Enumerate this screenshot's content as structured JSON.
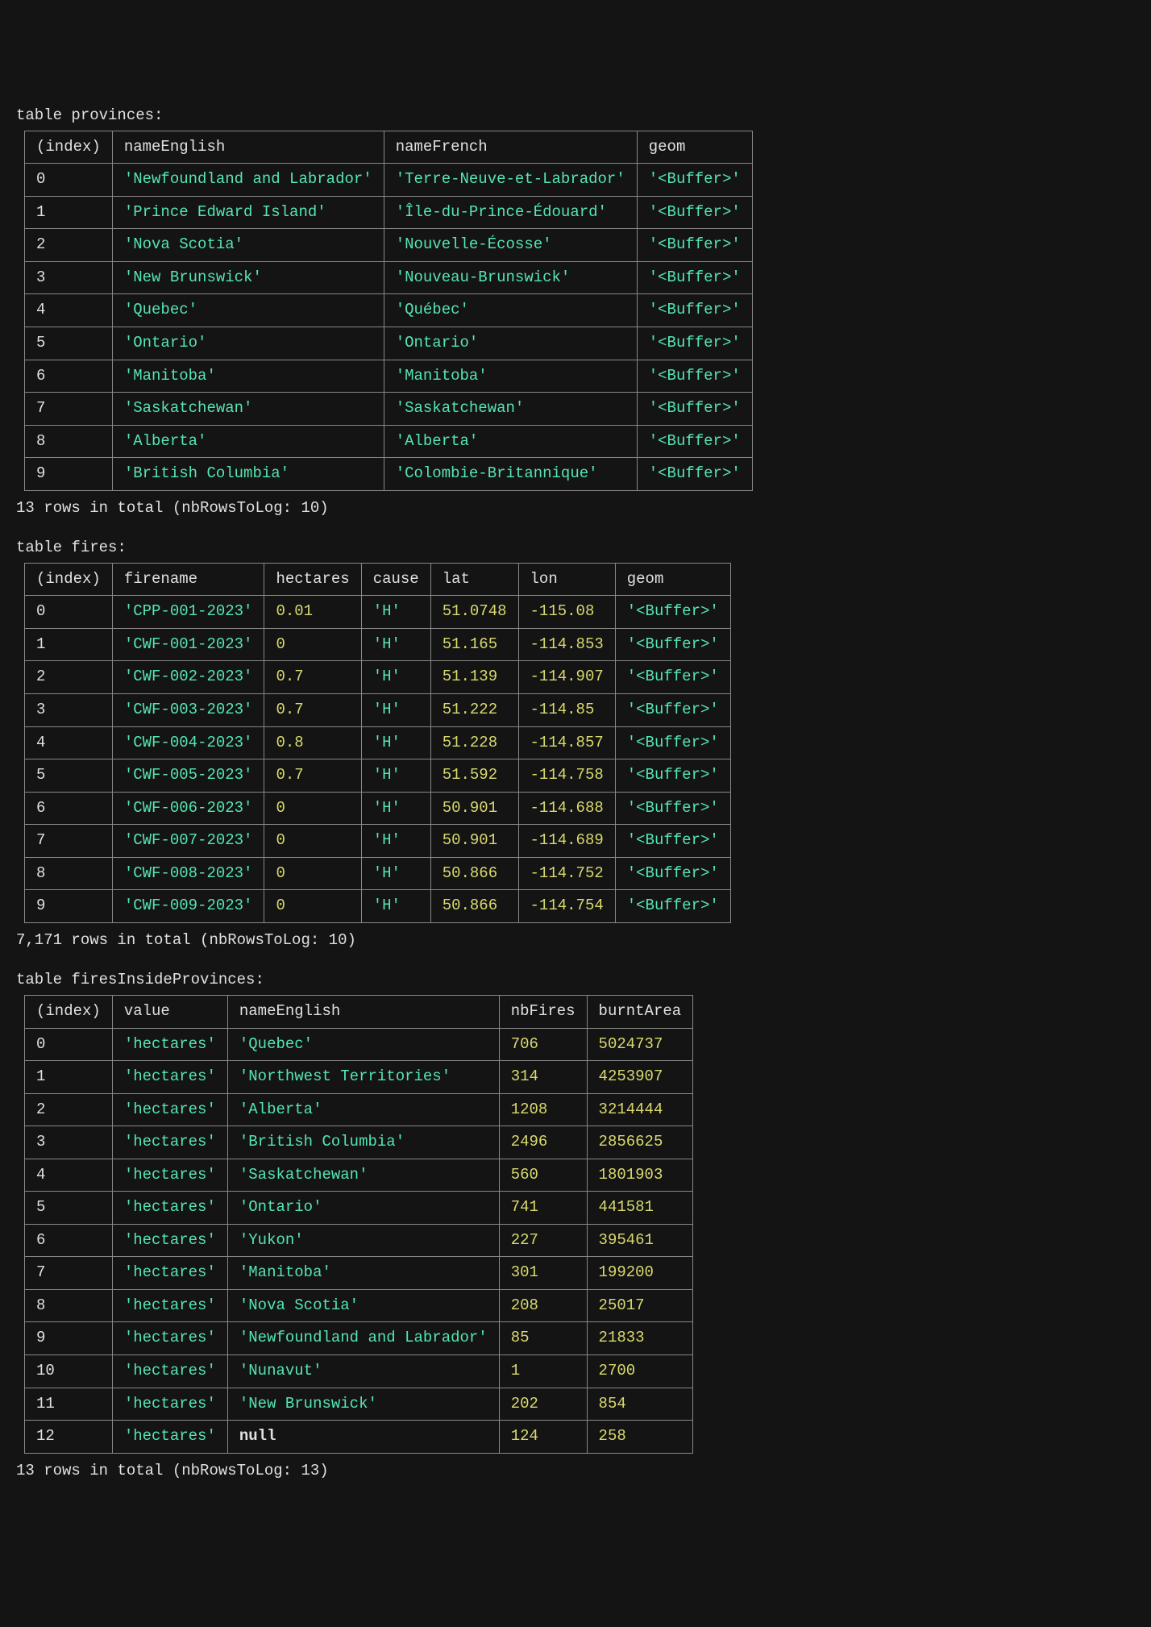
{
  "tables": [
    {
      "title": "table provinces:",
      "columns": [
        "(index)",
        "nameEnglish",
        "nameFrench",
        "geom"
      ],
      "rows": [
        [
          {
            "v": "0",
            "t": "idx"
          },
          {
            "v": "'Newfoundland and Labrador'",
            "t": "str"
          },
          {
            "v": "'Terre-Neuve-et-Labrador'",
            "t": "str"
          },
          {
            "v": "'<Buffer>'",
            "t": "str"
          }
        ],
        [
          {
            "v": "1",
            "t": "idx"
          },
          {
            "v": "'Prince Edward Island'",
            "t": "str"
          },
          {
            "v": "'Île-du-Prince-Édouard'",
            "t": "str"
          },
          {
            "v": "'<Buffer>'",
            "t": "str"
          }
        ],
        [
          {
            "v": "2",
            "t": "idx"
          },
          {
            "v": "'Nova Scotia'",
            "t": "str"
          },
          {
            "v": "'Nouvelle-Écosse'",
            "t": "str"
          },
          {
            "v": "'<Buffer>'",
            "t": "str"
          }
        ],
        [
          {
            "v": "3",
            "t": "idx"
          },
          {
            "v": "'New Brunswick'",
            "t": "str"
          },
          {
            "v": "'Nouveau-Brunswick'",
            "t": "str"
          },
          {
            "v": "'<Buffer>'",
            "t": "str"
          }
        ],
        [
          {
            "v": "4",
            "t": "idx"
          },
          {
            "v": "'Quebec'",
            "t": "str"
          },
          {
            "v": "'Québec'",
            "t": "str"
          },
          {
            "v": "'<Buffer>'",
            "t": "str"
          }
        ],
        [
          {
            "v": "5",
            "t": "idx"
          },
          {
            "v": "'Ontario'",
            "t": "str"
          },
          {
            "v": "'Ontario'",
            "t": "str"
          },
          {
            "v": "'<Buffer>'",
            "t": "str"
          }
        ],
        [
          {
            "v": "6",
            "t": "idx"
          },
          {
            "v": "'Manitoba'",
            "t": "str"
          },
          {
            "v": "'Manitoba'",
            "t": "str"
          },
          {
            "v": "'<Buffer>'",
            "t": "str"
          }
        ],
        [
          {
            "v": "7",
            "t": "idx"
          },
          {
            "v": "'Saskatchewan'",
            "t": "str"
          },
          {
            "v": "'Saskatchewan'",
            "t": "str"
          },
          {
            "v": "'<Buffer>'",
            "t": "str"
          }
        ],
        [
          {
            "v": "8",
            "t": "idx"
          },
          {
            "v": "'Alberta'",
            "t": "str"
          },
          {
            "v": "'Alberta'",
            "t": "str"
          },
          {
            "v": "'<Buffer>'",
            "t": "str"
          }
        ],
        [
          {
            "v": "9",
            "t": "idx"
          },
          {
            "v": "'British Columbia'",
            "t": "str"
          },
          {
            "v": "'Colombie-Britannique'",
            "t": "str"
          },
          {
            "v": "'<Buffer>'",
            "t": "str"
          }
        ]
      ],
      "summary": "13 rows in total (nbRowsToLog: 10)"
    },
    {
      "title": "table fires:",
      "columns": [
        "(index)",
        "firename",
        "hectares",
        "cause",
        "lat",
        "lon",
        "geom"
      ],
      "rows": [
        [
          {
            "v": "0",
            "t": "idx"
          },
          {
            "v": "'CPP-001-2023'",
            "t": "str"
          },
          {
            "v": "0.01",
            "t": "num"
          },
          {
            "v": "'H'",
            "t": "str"
          },
          {
            "v": "51.0748",
            "t": "num"
          },
          {
            "v": "-115.08",
            "t": "num"
          },
          {
            "v": "'<Buffer>'",
            "t": "str"
          }
        ],
        [
          {
            "v": "1",
            "t": "idx"
          },
          {
            "v": "'CWF-001-2023'",
            "t": "str"
          },
          {
            "v": "0",
            "t": "num"
          },
          {
            "v": "'H'",
            "t": "str"
          },
          {
            "v": "51.165",
            "t": "num"
          },
          {
            "v": "-114.853",
            "t": "num"
          },
          {
            "v": "'<Buffer>'",
            "t": "str"
          }
        ],
        [
          {
            "v": "2",
            "t": "idx"
          },
          {
            "v": "'CWF-002-2023'",
            "t": "str"
          },
          {
            "v": "0.7",
            "t": "num"
          },
          {
            "v": "'H'",
            "t": "str"
          },
          {
            "v": "51.139",
            "t": "num"
          },
          {
            "v": "-114.907",
            "t": "num"
          },
          {
            "v": "'<Buffer>'",
            "t": "str"
          }
        ],
        [
          {
            "v": "3",
            "t": "idx"
          },
          {
            "v": "'CWF-003-2023'",
            "t": "str"
          },
          {
            "v": "0.7",
            "t": "num"
          },
          {
            "v": "'H'",
            "t": "str"
          },
          {
            "v": "51.222",
            "t": "num"
          },
          {
            "v": "-114.85",
            "t": "num"
          },
          {
            "v": "'<Buffer>'",
            "t": "str"
          }
        ],
        [
          {
            "v": "4",
            "t": "idx"
          },
          {
            "v": "'CWF-004-2023'",
            "t": "str"
          },
          {
            "v": "0.8",
            "t": "num"
          },
          {
            "v": "'H'",
            "t": "str"
          },
          {
            "v": "51.228",
            "t": "num"
          },
          {
            "v": "-114.857",
            "t": "num"
          },
          {
            "v": "'<Buffer>'",
            "t": "str"
          }
        ],
        [
          {
            "v": "5",
            "t": "idx"
          },
          {
            "v": "'CWF-005-2023'",
            "t": "str"
          },
          {
            "v": "0.7",
            "t": "num"
          },
          {
            "v": "'H'",
            "t": "str"
          },
          {
            "v": "51.592",
            "t": "num"
          },
          {
            "v": "-114.758",
            "t": "num"
          },
          {
            "v": "'<Buffer>'",
            "t": "str"
          }
        ],
        [
          {
            "v": "6",
            "t": "idx"
          },
          {
            "v": "'CWF-006-2023'",
            "t": "str"
          },
          {
            "v": "0",
            "t": "num"
          },
          {
            "v": "'H'",
            "t": "str"
          },
          {
            "v": "50.901",
            "t": "num"
          },
          {
            "v": "-114.688",
            "t": "num"
          },
          {
            "v": "'<Buffer>'",
            "t": "str"
          }
        ],
        [
          {
            "v": "7",
            "t": "idx"
          },
          {
            "v": "'CWF-007-2023'",
            "t": "str"
          },
          {
            "v": "0",
            "t": "num"
          },
          {
            "v": "'H'",
            "t": "str"
          },
          {
            "v": "50.901",
            "t": "num"
          },
          {
            "v": "-114.689",
            "t": "num"
          },
          {
            "v": "'<Buffer>'",
            "t": "str"
          }
        ],
        [
          {
            "v": "8",
            "t": "idx"
          },
          {
            "v": "'CWF-008-2023'",
            "t": "str"
          },
          {
            "v": "0",
            "t": "num"
          },
          {
            "v": "'H'",
            "t": "str"
          },
          {
            "v": "50.866",
            "t": "num"
          },
          {
            "v": "-114.752",
            "t": "num"
          },
          {
            "v": "'<Buffer>'",
            "t": "str"
          }
        ],
        [
          {
            "v": "9",
            "t": "idx"
          },
          {
            "v": "'CWF-009-2023'",
            "t": "str"
          },
          {
            "v": "0",
            "t": "num"
          },
          {
            "v": "'H'",
            "t": "str"
          },
          {
            "v": "50.866",
            "t": "num"
          },
          {
            "v": "-114.754",
            "t": "num"
          },
          {
            "v": "'<Buffer>'",
            "t": "str"
          }
        ]
      ],
      "summary": "7,171 rows in total (nbRowsToLog: 10)"
    },
    {
      "title": "table firesInsideProvinces:",
      "columns": [
        "(index)",
        "value",
        "nameEnglish",
        "nbFires",
        "burntArea"
      ],
      "rows": [
        [
          {
            "v": "0",
            "t": "idx"
          },
          {
            "v": "'hectares'",
            "t": "str"
          },
          {
            "v": "'Quebec'",
            "t": "str"
          },
          {
            "v": "706",
            "t": "num"
          },
          {
            "v": "5024737",
            "t": "num"
          }
        ],
        [
          {
            "v": "1",
            "t": "idx"
          },
          {
            "v": "'hectares'",
            "t": "str"
          },
          {
            "v": "'Northwest Territories'",
            "t": "str"
          },
          {
            "v": "314",
            "t": "num"
          },
          {
            "v": "4253907",
            "t": "num"
          }
        ],
        [
          {
            "v": "2",
            "t": "idx"
          },
          {
            "v": "'hectares'",
            "t": "str"
          },
          {
            "v": "'Alberta'",
            "t": "str"
          },
          {
            "v": "1208",
            "t": "num"
          },
          {
            "v": "3214444",
            "t": "num"
          }
        ],
        [
          {
            "v": "3",
            "t": "idx"
          },
          {
            "v": "'hectares'",
            "t": "str"
          },
          {
            "v": "'British Columbia'",
            "t": "str"
          },
          {
            "v": "2496",
            "t": "num"
          },
          {
            "v": "2856625",
            "t": "num"
          }
        ],
        [
          {
            "v": "4",
            "t": "idx"
          },
          {
            "v": "'hectares'",
            "t": "str"
          },
          {
            "v": "'Saskatchewan'",
            "t": "str"
          },
          {
            "v": "560",
            "t": "num"
          },
          {
            "v": "1801903",
            "t": "num"
          }
        ],
        [
          {
            "v": "5",
            "t": "idx"
          },
          {
            "v": "'hectares'",
            "t": "str"
          },
          {
            "v": "'Ontario'",
            "t": "str"
          },
          {
            "v": "741",
            "t": "num"
          },
          {
            "v": "441581",
            "t": "num"
          }
        ],
        [
          {
            "v": "6",
            "t": "idx"
          },
          {
            "v": "'hectares'",
            "t": "str"
          },
          {
            "v": "'Yukon'",
            "t": "str"
          },
          {
            "v": "227",
            "t": "num"
          },
          {
            "v": "395461",
            "t": "num"
          }
        ],
        [
          {
            "v": "7",
            "t": "idx"
          },
          {
            "v": "'hectares'",
            "t": "str"
          },
          {
            "v": "'Manitoba'",
            "t": "str"
          },
          {
            "v": "301",
            "t": "num"
          },
          {
            "v": "199200",
            "t": "num"
          }
        ],
        [
          {
            "v": "8",
            "t": "idx"
          },
          {
            "v": "'hectares'",
            "t": "str"
          },
          {
            "v": "'Nova Scotia'",
            "t": "str"
          },
          {
            "v": "208",
            "t": "num"
          },
          {
            "v": "25017",
            "t": "num"
          }
        ],
        [
          {
            "v": "9",
            "t": "idx"
          },
          {
            "v": "'hectares'",
            "t": "str"
          },
          {
            "v": "'Newfoundland and Labrador'",
            "t": "str"
          },
          {
            "v": "85",
            "t": "num"
          },
          {
            "v": "21833",
            "t": "num"
          }
        ],
        [
          {
            "v": "10",
            "t": "idx"
          },
          {
            "v": "'hectares'",
            "t": "str"
          },
          {
            "v": "'Nunavut'",
            "t": "str"
          },
          {
            "v": "1",
            "t": "num"
          },
          {
            "v": "2700",
            "t": "num"
          }
        ],
        [
          {
            "v": "11",
            "t": "idx"
          },
          {
            "v": "'hectares'",
            "t": "str"
          },
          {
            "v": "'New Brunswick'",
            "t": "str"
          },
          {
            "v": "202",
            "t": "num"
          },
          {
            "v": "854",
            "t": "num"
          }
        ],
        [
          {
            "v": "12",
            "t": "idx"
          },
          {
            "v": "'hectares'",
            "t": "str"
          },
          {
            "v": "null",
            "t": "null"
          },
          {
            "v": "124",
            "t": "num"
          },
          {
            "v": "258",
            "t": "num"
          }
        ]
      ],
      "summary": "13 rows in total (nbRowsToLog: 13)"
    }
  ]
}
